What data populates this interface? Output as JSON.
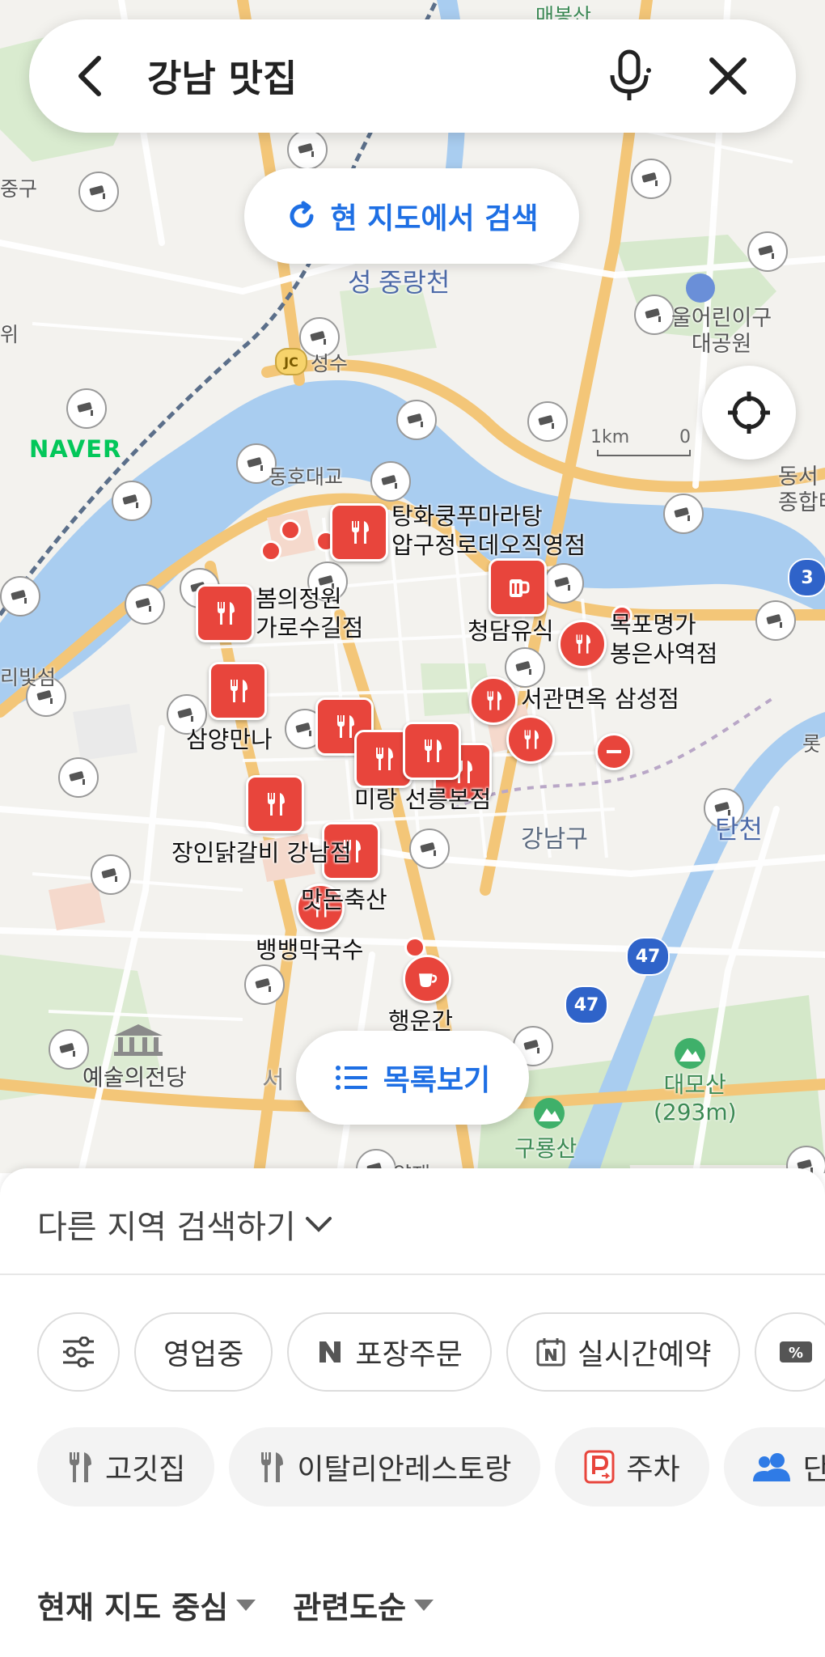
{
  "search": {
    "query": "강남 맛집"
  },
  "map": {
    "research_label": "현 지도에서 검색",
    "list_label": "목록보기",
    "brand": "NAVER",
    "scale_left": "1km",
    "scale_right": "0",
    "labels": {
      "jung_gu": "중구",
      "wi": "위",
      "jungnangcheon": "중랑천",
      "seong_gan": "성",
      "jc": "JC",
      "seongsu": "성수",
      "dongho": "동호대교",
      "children_park": "울어린이구\n대공원",
      "dongseoul": "동서\n종합터",
      "route3": "3",
      "yongsan_side": "리빛섬",
      "lotte": "롯",
      "gangnam_gu": "강남구",
      "tancheon": "탄천",
      "route47a": "47",
      "route47b": "47",
      "daemosan": "대모산\n(293m)",
      "guryongsan": "구룡산",
      "arts_center": "예술의전당",
      "seo": "서",
      "yangjae": "양재",
      "maebongsan": "매봉산"
    },
    "places": [
      {
        "name": "탕화쿵푸마라탕\n압구정로데오직영점"
      },
      {
        "name": "봄의정원\n가로수길점"
      },
      {
        "name": "청담유식"
      },
      {
        "name": "목포명가\n봉은사역점"
      },
      {
        "name": "서관면옥 삼성점"
      },
      {
        "name": "삼양만나"
      },
      {
        "name": "미랑 선릉본점"
      },
      {
        "name": "장인닭갈비 강남점"
      },
      {
        "name": "맛돈축산"
      },
      {
        "name": "뱅뱅막국수"
      },
      {
        "name": "행운간"
      }
    ]
  },
  "sheet": {
    "other_area": "다른 지역 검색하기",
    "filters": [
      {
        "label": ""
      },
      {
        "label": "영업중"
      },
      {
        "label": "포장주문"
      },
      {
        "label": "실시간예약"
      },
      {
        "label": ""
      }
    ],
    "categories": [
      {
        "label": "고깃집"
      },
      {
        "label": "이탈리안레스토랑"
      },
      {
        "label": "주차"
      },
      {
        "label": "단"
      }
    ],
    "sort": [
      {
        "label": "현재 지도 중심"
      },
      {
        "label": "관련도순"
      }
    ]
  },
  "colors": {
    "accent": "#1e6fe4",
    "pin": "#e8453c",
    "naver": "#03c75a",
    "river": "#a9cdf0"
  }
}
